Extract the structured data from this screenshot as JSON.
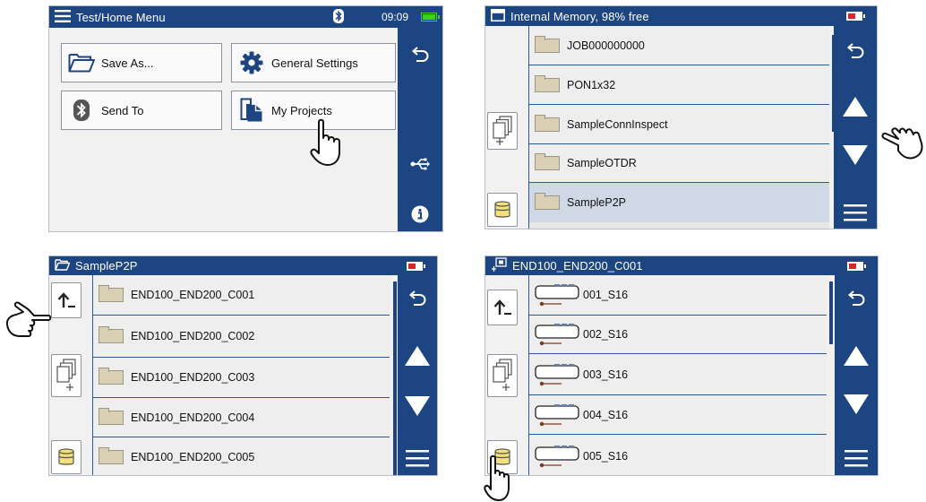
{
  "panel1": {
    "title": "Test/Home Menu",
    "time": "09:09",
    "buttons": {
      "save_as": "Save As...",
      "general_settings": "General Settings",
      "send_to": "Send To",
      "my_projects": "My Projects"
    },
    "icons": [
      "menu-icon",
      "bluetooth-icon",
      "battery-icon",
      "back-icon",
      "usb-icon",
      "info-icon"
    ]
  },
  "panel2": {
    "title": "Internal Memory, 98% free",
    "items": [
      "JOB000000000",
      "PON1x32",
      "SampleConnInspect",
      "SampleOTDR",
      "SampleP2P"
    ],
    "selected_index": 4
  },
  "panel3": {
    "title": "SampleP2P",
    "items": [
      "END100_END200_C001",
      "END100_END200_C002",
      "END100_END200_C003",
      "END100_END200_C004",
      "END100_END200_C005"
    ]
  },
  "panel4": {
    "title": "END100_END200_C001",
    "items": [
      "001_S16",
      "002_S16",
      "003_S16",
      "004_S16",
      "005_S16"
    ]
  },
  "colors": {
    "titlebar": "#1d4581",
    "row_divider": "#2a5b96",
    "selected_row": "#cfd9e6",
    "battery_low": "#e0202a",
    "battery_full": "#3bd21c"
  }
}
